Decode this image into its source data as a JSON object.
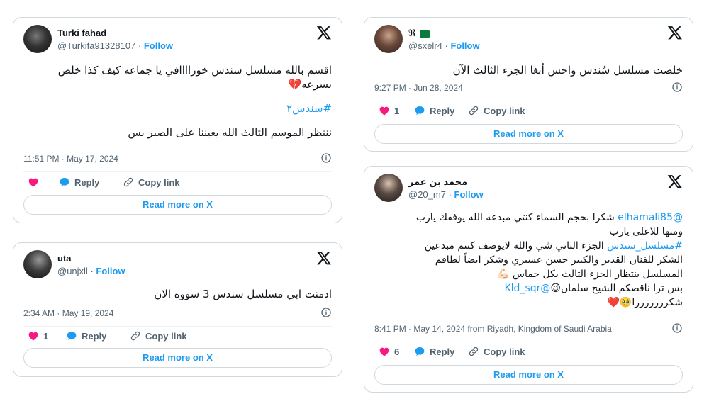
{
  "colors": {
    "accent": "#1d9bf0",
    "heart": "#f91880",
    "border": "#cfd9de",
    "muted": "#536471"
  },
  "tweets": {
    "t1": {
      "name": "Turki fahad",
      "handle": "@Turkifa91328107",
      "follow": "Follow",
      "text_line1": "اقسم بالله مسلسل سندس خوراااافي يا جماعه كيف كذا خلص",
      "text_line2": "بسرعه💔",
      "hashtag": "#سندس٢",
      "text_line3": "ننتظر الموسم الثالث الله يعيننا على الصبر بس",
      "meta": "11:51 PM · May 17, 2024",
      "likes": "",
      "reply": "Reply",
      "copy": "Copy link",
      "read_more": "Read more on X"
    },
    "t2": {
      "name": "ℜ",
      "handle": "@sxelr4",
      "follow": "Follow",
      "text_line1": "خلصت مسلسل سُندس واحس أبغا الجزء الثالث الآن",
      "meta": "9:27 PM · Jun 28, 2024",
      "likes": "1",
      "reply": "Reply",
      "copy": "Copy link",
      "read_more": "Read more on X"
    },
    "t3": {
      "name": "محمد بن عمر",
      "handle": "@20_m7",
      "follow": "Follow",
      "mention1": "@elhamali85",
      "line1": " شكرا بحجم السماء كنتي مبدعه الله يوفقك يارب",
      "line2": "ومنها للاعلى يارب",
      "hashtag": "#مسلسل_سندس",
      "line3": " الجزء الثاني شي والله لايوصف كنتم مبدعين",
      "line4": "الشكر للفنان القدير والكبير حسن عسيري وشكر ايضاً لطاقم",
      "line5": "المسلسل بنتظار الجزء الثالث بكل حماس 💪🏻",
      "line6a": "بس ترا ناقصكم الشيخ سلمان😉",
      "mention2": "@Kld_sqr",
      "line7": "شكرررررررا🥹❤️",
      "meta": "8:41 PM · May 14, 2024 from Riyadh, Kingdom of Saudi Arabia",
      "likes": "6",
      "reply": "Reply",
      "copy": "Copy link",
      "read_more": "Read more on X"
    },
    "t4": {
      "name": "uta",
      "handle": "@unjxll",
      "follow": "Follow",
      "text_line1": "ادمنت ابي مسلسل سندس 3 سووه الان",
      "meta": "2:34 AM · May 19, 2024",
      "likes": "1",
      "reply": "Reply",
      "copy": "Copy link",
      "read_more": "Read more on X"
    }
  }
}
